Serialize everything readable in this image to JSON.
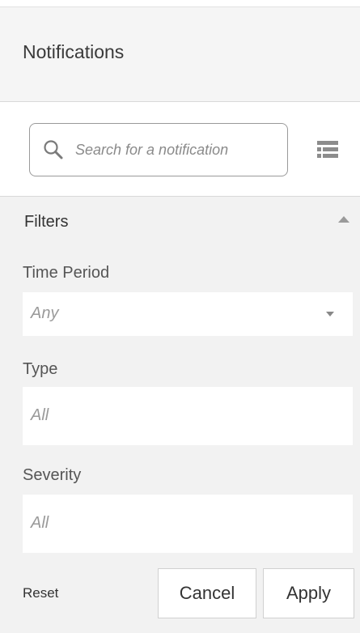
{
  "header": {
    "title": "Notifications"
  },
  "search": {
    "placeholder": "Search for a notification",
    "value": "",
    "icon": "search-icon"
  },
  "toolbar": {
    "list_view_icon": "list-view-icon"
  },
  "filters": {
    "label": "Filters",
    "expanded": true,
    "fields": {
      "time_period": {
        "label": "Time Period",
        "value": "Any",
        "control": "dropdown"
      },
      "type": {
        "label": "Type",
        "value": "All",
        "control": "multiselect"
      },
      "severity": {
        "label": "Severity",
        "value": "All",
        "control": "multiselect"
      }
    }
  },
  "actions": {
    "reset_label": "Reset",
    "cancel_label": "Cancel",
    "apply_label": "Apply"
  },
  "colors": {
    "header_bg": "#f5f5f5",
    "filters_bg": "#f2f2f2",
    "field_bg": "#ffffff",
    "placeholder_text": "#9a9a9a"
  }
}
